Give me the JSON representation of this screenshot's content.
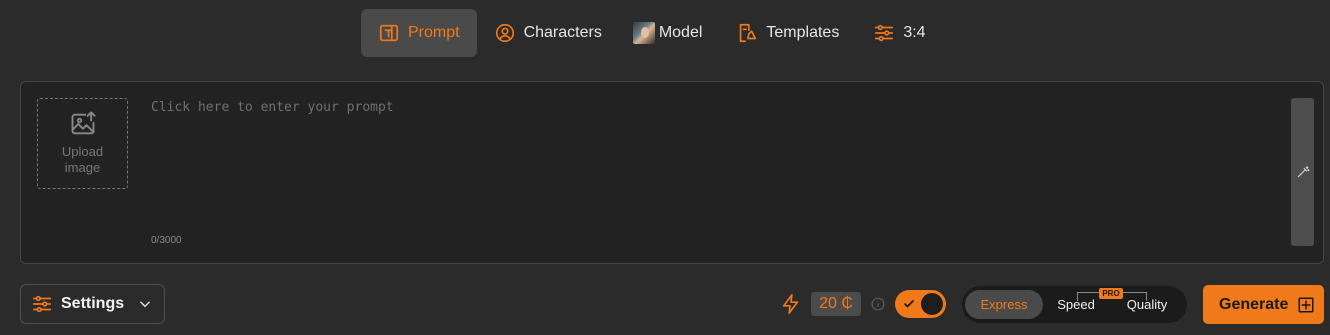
{
  "tabs": [
    {
      "label": "Prompt",
      "icon": "text-prompt-icon",
      "active": true
    },
    {
      "label": "Characters",
      "icon": "character-icon"
    },
    {
      "label": "Model",
      "icon": "model-thumbnail"
    },
    {
      "label": "Templates",
      "icon": "templates-icon"
    },
    {
      "label": "3:4",
      "icon": "sliders-icon"
    }
  ],
  "prompt": {
    "placeholder": "Click here to enter your prompt",
    "value": "",
    "counter": "0/3000",
    "upload_label": "Upload image"
  },
  "bottom": {
    "settings_label": "Settings",
    "credits": "20 ₵",
    "toggle_on": true,
    "modes": [
      "Express",
      "Speed",
      "Quality"
    ],
    "active_mode": "Express",
    "pro_badge": "PRO",
    "generate_label": "Generate"
  },
  "colors": {
    "accent": "#f07a1a",
    "background": "#2b2b2b",
    "panel": "#222222"
  }
}
